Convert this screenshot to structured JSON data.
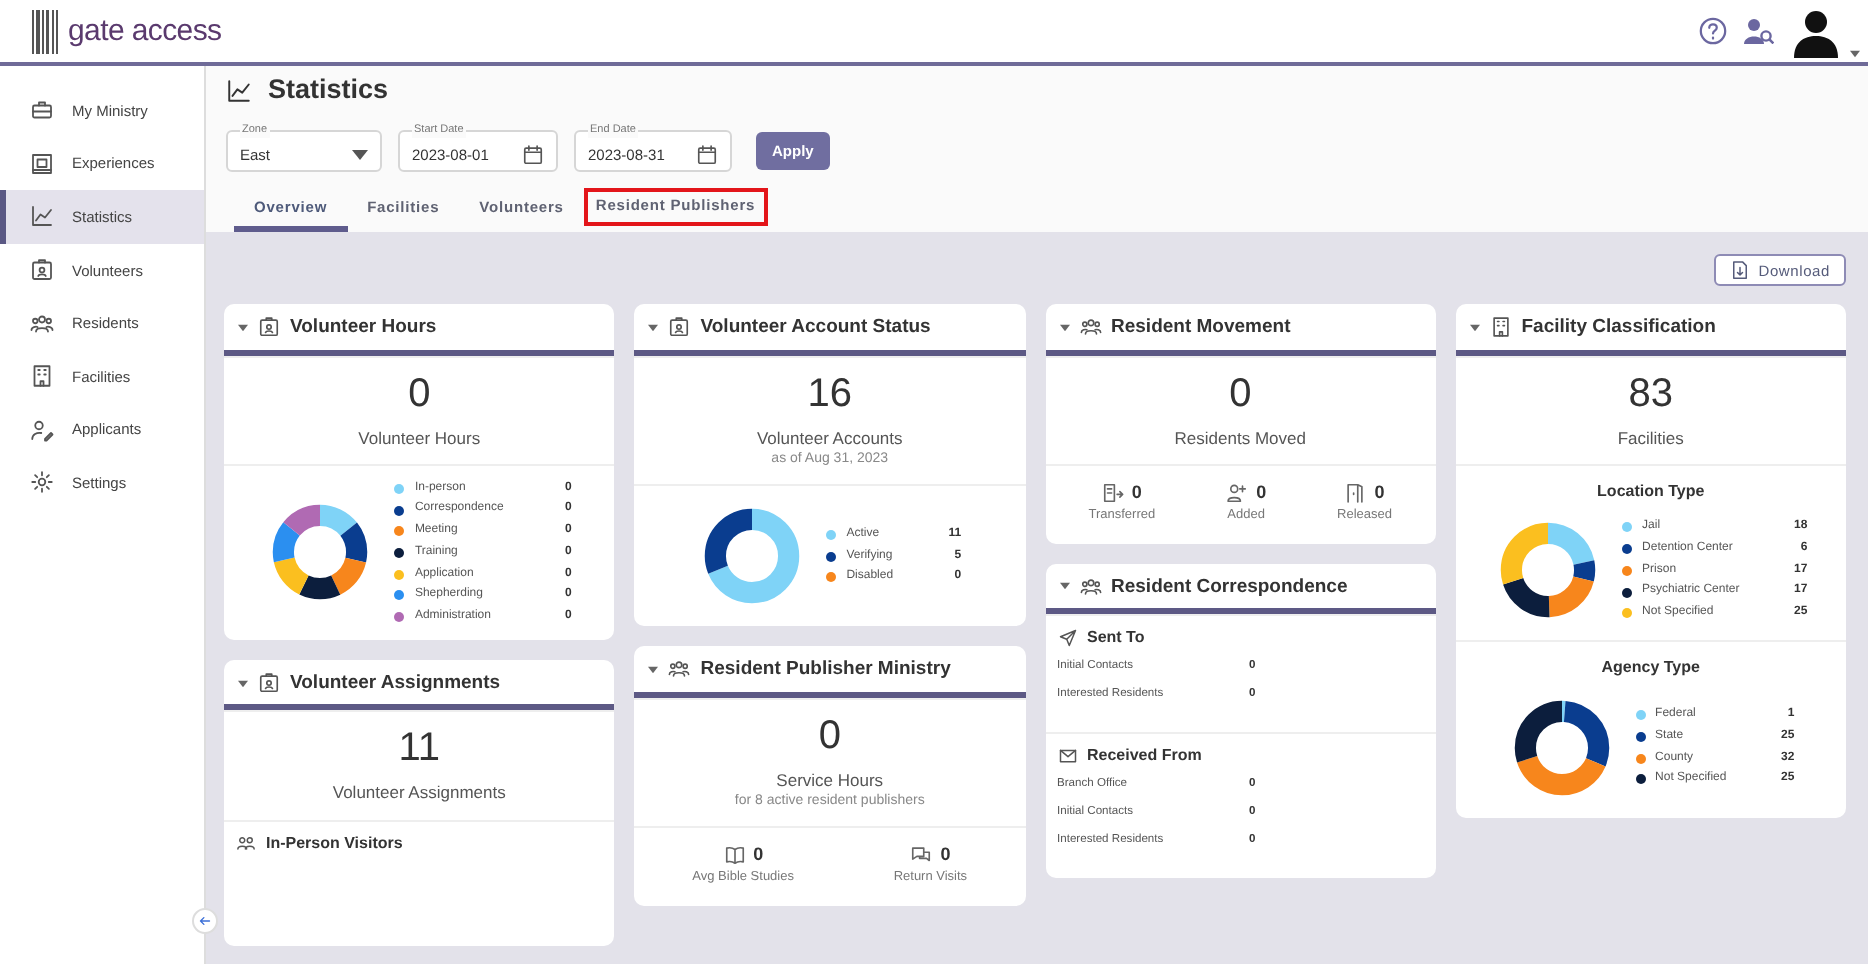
{
  "header": {
    "logo": "gate access"
  },
  "sidebar": {
    "items": [
      {
        "label": "My Ministry",
        "selected": false
      },
      {
        "label": "Experiences",
        "selected": false
      },
      {
        "label": "Statistics",
        "selected": true
      },
      {
        "label": "Volunteers",
        "selected": false
      },
      {
        "label": "Residents",
        "selected": false
      },
      {
        "label": "Facilities",
        "selected": false
      },
      {
        "label": "Applicants",
        "selected": false
      },
      {
        "label": "Settings",
        "selected": false
      }
    ]
  },
  "page": {
    "title": "Statistics"
  },
  "filters": {
    "zone": {
      "label": "Zone",
      "value": "East"
    },
    "start_date": {
      "label": "Start Date",
      "value": "2023-08-01"
    },
    "end_date": {
      "label": "End Date",
      "value": "2023-08-31"
    },
    "apply": "Apply"
  },
  "tabs": [
    {
      "label": "Overview",
      "selected": true,
      "highlighted": false
    },
    {
      "label": "Facilities",
      "selected": false,
      "highlighted": false
    },
    {
      "label": "Volunteers",
      "selected": false,
      "highlighted": false
    },
    {
      "label": "Resident Publishers",
      "selected": false,
      "highlighted": true
    }
  ],
  "download": "Download",
  "columns": [
    {
      "cards": [
        {
          "title": "Volunteer Hours",
          "sections": [
            {
              "kind": "total",
              "value": "0",
              "caption": "Volunteer Hours"
            },
            {
              "kind": "donut",
              "legend": [
                {
                  "label": "In-person",
                  "value": "0",
                  "color": "#7fd3f7"
                },
                {
                  "label": "Correspondence",
                  "value": "0",
                  "color": "#0a3d8f"
                },
                {
                  "label": "Meeting",
                  "value": "0",
                  "color": "#f7861c"
                },
                {
                  "label": "Training",
                  "value": "0",
                  "color": "#0c1e3d"
                },
                {
                  "label": "Application",
                  "value": "0",
                  "color": "#fbbf1f"
                },
                {
                  "label": "Shepherding",
                  "value": "0",
                  "color": "#2b8ff0"
                },
                {
                  "label": "Administration",
                  "value": "0",
                  "color": "#b06ab3"
                }
              ]
            }
          ]
        },
        {
          "title": "Volunteer Assignments",
          "sections": [
            {
              "kind": "total",
              "value": "11",
              "caption": "Volunteer Assignments"
            },
            {
              "kind": "list",
              "title": "In-Person Visitors"
            }
          ]
        }
      ]
    },
    {
      "cards": [
        {
          "title": "Volunteer Account Status",
          "sections": [
            {
              "kind": "total",
              "value": "16",
              "caption": "Volunteer Accounts",
              "subcaption": "as of Aug 31, 2023"
            },
            {
              "kind": "donut",
              "legend": [
                {
                  "label": "Active",
                  "value": "11",
                  "color": "#7fd3f7"
                },
                {
                  "label": "Verifying",
                  "value": "5",
                  "color": "#0a3d8f"
                },
                {
                  "label": "Disabled",
                  "value": "0",
                  "color": "#f7861c"
                }
              ]
            }
          ]
        },
        {
          "title": "Resident Publisher Ministry",
          "sections": [
            {
              "kind": "total",
              "value": "0",
              "caption": "Service Hours",
              "subcaption": "for 8 active resident publishers"
            },
            {
              "kind": "stats",
              "items": [
                {
                  "value": "0",
                  "label": "Avg Bible Studies"
                },
                {
                  "value": "0",
                  "label": "Return Visits"
                }
              ]
            }
          ]
        }
      ]
    },
    {
      "cards": [
        {
          "title": "Resident Movement",
          "sections": [
            {
              "kind": "total",
              "value": "0",
              "caption": "Residents Moved"
            },
            {
              "kind": "stats",
              "items": [
                {
                  "value": "0",
                  "label": "Transferred"
                },
                {
                  "value": "0",
                  "label": "Added"
                },
                {
                  "value": "0",
                  "label": "Released"
                }
              ]
            }
          ]
        },
        {
          "title": "Resident Correspondence",
          "sections": [
            {
              "kind": "list",
              "title": "Sent To",
              "rows": [
                {
                  "label": "Initial Contacts",
                  "value": "0"
                },
                {
                  "label": "Interested Residents",
                  "value": "0"
                }
              ]
            },
            {
              "kind": "list",
              "title": "Received From",
              "rows": [
                {
                  "label": "Branch Office",
                  "value": "0"
                },
                {
                  "label": "Initial Contacts",
                  "value": "0"
                },
                {
                  "label": "Interested Residents",
                  "value": "0"
                }
              ]
            }
          ]
        }
      ]
    },
    {
      "cards": [
        {
          "title": "Facility Classification",
          "sections": [
            {
              "kind": "total",
              "value": "83",
              "caption": "Facilities"
            },
            {
              "kind": "donut",
              "title": "Location Type",
              "legend": [
                {
                  "label": "Jail",
                  "value": "18",
                  "color": "#7fd3f7"
                },
                {
                  "label": "Detention Center",
                  "value": "6",
                  "color": "#0a3d8f"
                },
                {
                  "label": "Prison",
                  "value": "17",
                  "color": "#f7861c"
                },
                {
                  "label": "Psychiatric Center",
                  "value": "17",
                  "color": "#0c1e3d"
                },
                {
                  "label": "Not Specified",
                  "value": "25",
                  "color": "#fbbf1f"
                }
              ]
            },
            {
              "kind": "donut",
              "title": "Agency Type",
              "legend": [
                {
                  "label": "Federal",
                  "value": "1",
                  "color": "#7fd3f7"
                },
                {
                  "label": "State",
                  "value": "25",
                  "color": "#0a3d8f"
                },
                {
                  "label": "County",
                  "value": "32",
                  "color": "#f7861c"
                },
                {
                  "label": "Not Specified",
                  "value": "25",
                  "color": "#0c1e3d"
                }
              ]
            }
          ]
        }
      ]
    }
  ]
}
